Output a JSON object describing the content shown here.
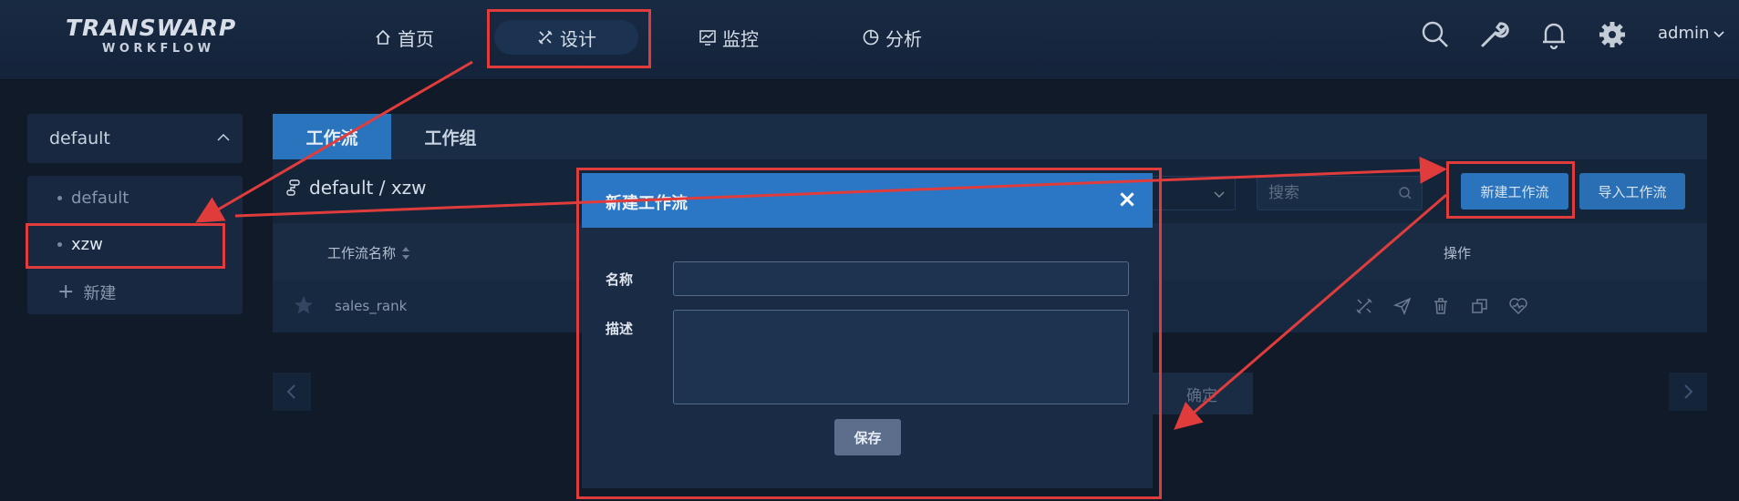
{
  "logo": {
    "main": "TRANSWARP",
    "sub": "WORKFLOW"
  },
  "nav": [
    {
      "label": "首页",
      "icon": "home-icon"
    },
    {
      "label": "设计",
      "icon": "design-icon"
    },
    {
      "label": "监控",
      "icon": "monitor-icon"
    },
    {
      "label": "分析",
      "icon": "analysis-icon"
    }
  ],
  "top_icons": [
    "search-icon",
    "wrench-icon",
    "bell-icon",
    "gear-icon"
  ],
  "user": {
    "name": "admin"
  },
  "left": {
    "project_select": "default",
    "items": [
      "default",
      "xzw"
    ],
    "new_label": "新建"
  },
  "main": {
    "tabs": [
      "工作流",
      "工作组"
    ],
    "breadcrumb": "default / xzw",
    "search_placeholder": "搜索",
    "new_workflow_button": "新建工作流",
    "import_workflow_button": "导入工作流",
    "table": {
      "headers": [
        "工作流名称",
        "操作"
      ],
      "rows": [
        {
          "name": "sales_rank"
        }
      ]
    },
    "confirm_button": "确定"
  },
  "modal": {
    "title": "新建工作流",
    "close": "×",
    "name_label": "名称",
    "desc_label": "描述",
    "save_button": "保存"
  },
  "colors": {
    "annotation": "#e03c3c",
    "accent": "#2a74be",
    "background": "#101a28"
  }
}
